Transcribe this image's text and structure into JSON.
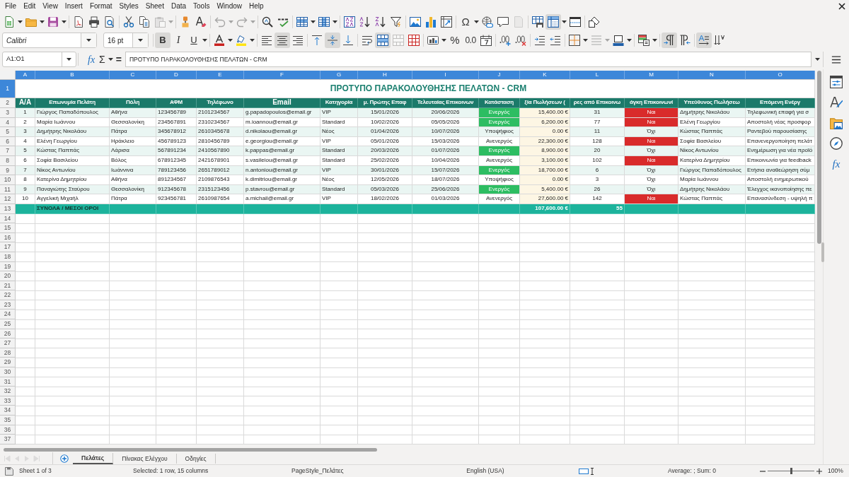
{
  "menu_bar": {
    "items": [
      "File",
      "Edit",
      "View",
      "Insert",
      "Format",
      "Styles",
      "Sheet",
      "Data",
      "Tools",
      "Window",
      "Help"
    ]
  },
  "standard_toolbar": {
    "paste": {
      "disabled": true
    },
    "undo": {
      "disabled": true
    },
    "redo": {
      "disabled": true
    },
    "special_character": {
      "label": "Ω"
    },
    "header_footer": {
      "disabled": true
    },
    "freeze": {
      "on": true
    }
  },
  "formatting_toolbar": {
    "font_name": "Calibri",
    "font_size": "16 pt",
    "bold": {
      "label": "B",
      "on": true
    },
    "italic": {
      "label": "I",
      "on": false
    },
    "underline": {
      "label": "U",
      "on": false
    },
    "align_left": {
      "on": false
    },
    "align_center": {
      "on": true
    },
    "align_right": {
      "on": false
    },
    "align_top": {
      "on": false
    },
    "center_vertically": {
      "on": true
    },
    "align_bottom": {
      "on": false
    },
    "wrap_text": {
      "on": false
    },
    "merge_and_center": {
      "on": true
    },
    "merge_cells": {
      "disabled": true
    },
    "percent": {
      "label": "%"
    },
    "number": {
      "label": "0.0"
    },
    "border_style": {
      "disabled": true
    },
    "left_to_right": {
      "on": true
    },
    "right_to_left": {
      "on": false
    },
    "text_left_to_right": {
      "on": true
    },
    "text_top_to_bottom": {
      "on": false
    }
  },
  "formula_bar": {
    "name_box": "A1:O1",
    "function_wizard": "fx",
    "sum": "Σ",
    "formula": "=",
    "content": "ΠΡΟΤΥΠΟ ΠΑΡΑΚΟΛΟΥΘΗΣΗΣ ΠΕΛΑΤΩΝ - CRM"
  },
  "sheet": {
    "column_headers": [
      {
        "label": "A",
        "selected": true
      },
      {
        "label": "B",
        "selected": true
      },
      {
        "label": "C",
        "selected": true
      },
      {
        "label": "D",
        "selected": true
      },
      {
        "label": "E",
        "selected": true
      },
      {
        "label": "F",
        "selected": true
      },
      {
        "label": "G",
        "selected": true
      },
      {
        "label": "H",
        "selected": true
      },
      {
        "label": "I",
        "selected": true
      },
      {
        "label": "J",
        "selected": true
      },
      {
        "label": "K",
        "selected": true
      },
      {
        "label": "L",
        "selected": true
      },
      {
        "label": "M",
        "selected": true
      },
      {
        "label": "N",
        "selected": true
      },
      {
        "label": "O",
        "selected": true
      }
    ],
    "row_headers": [
      {
        "label": "1",
        "selected": true
      },
      {
        "label": "2",
        "selected": false
      },
      {
        "label": "3",
        "selected": false
      },
      {
        "label": "4",
        "selected": false
      },
      {
        "label": "5",
        "selected": false
      },
      {
        "label": "6",
        "selected": false
      },
      {
        "label": "7",
        "selected": false
      },
      {
        "label": "8",
        "selected": false
      },
      {
        "label": "9",
        "selected": false
      },
      {
        "label": "10",
        "selected": false
      },
      {
        "label": "11",
        "selected": false
      },
      {
        "label": "12",
        "selected": false
      },
      {
        "label": "13",
        "selected": false
      },
      {
        "label": "14",
        "selected": false
      },
      {
        "label": "15",
        "selected": false
      },
      {
        "label": "16",
        "selected": false
      },
      {
        "label": "17",
        "selected": false
      },
      {
        "label": "18",
        "selected": false
      },
      {
        "label": "19",
        "selected": false
      },
      {
        "label": "20",
        "selected": false
      },
      {
        "label": "21",
        "selected": false
      },
      {
        "label": "22",
        "selected": false
      },
      {
        "label": "23",
        "selected": false
      },
      {
        "label": "24",
        "selected": false
      },
      {
        "label": "25",
        "selected": false
      },
      {
        "label": "26",
        "selected": false
      },
      {
        "label": "27",
        "selected": false
      },
      {
        "label": "28",
        "selected": false
      },
      {
        "label": "29",
        "selected": false
      },
      {
        "label": "30",
        "selected": false
      },
      {
        "label": "31",
        "selected": false
      },
      {
        "label": "32",
        "selected": false
      },
      {
        "label": "33",
        "selected": false
      },
      {
        "label": "34",
        "selected": false
      },
      {
        "label": "35",
        "selected": false
      },
      {
        "label": "36",
        "selected": false
      },
      {
        "label": "37",
        "selected": false
      }
    ],
    "title": "ΠΡΟΤΥΠΟ ΠΑΡΑΚΟΛΟΥΘΗΣΗΣ ΠΕΛΑΤΩΝ - CRM",
    "columns": [
      "Α/Α",
      "Επωνυμία Πελάτη",
      "Πόλη",
      "ΑΦΜ",
      "Τηλέφωνο",
      "Email",
      "Κατηγορία",
      "μ. Πρώτης Επαφ",
      "Τελευταίας Επικοινων",
      "Κατάσταση",
      "ξία Πωλήσεων (",
      "ρες από Επικοινω",
      "άγκη Επικοινωνί",
      "Υπεύθυνος Πωλήσεω",
      "Επόμενη Ενέργ"
    ],
    "rows": [
      {
        "cells": [
          "1",
          "Γιώργος Παπαδόπουλος",
          "Αθήνα",
          "123456789",
          "2101234567",
          "g.papadopoulos@email.gr",
          "VIP",
          "15/01/2026",
          "20/06/2026",
          "Ενεργός",
          "15,400.00 €",
          "31",
          "Ναι",
          "Δημήτρης Νικολάου",
          "Τηλεφωνική επαφή για σ"
        ],
        "status_highlighted": true,
        "contact_highlighted": true
      },
      {
        "cells": [
          "2",
          "Μαρία Ιωάννου",
          "Θεσσαλονίκη",
          "234567891",
          "2310234567",
          "m.ioannou@email.gr",
          "Standard",
          "10/02/2026",
          "05/05/2026",
          "Ενεργός",
          "6,200.00 €",
          "77",
          "Ναι",
          "Ελένη Γεωργίου",
          "Αποστολή νέας προσφορ"
        ],
        "status_highlighted": true,
        "contact_highlighted": true
      },
      {
        "cells": [
          "3",
          "Δημήτρης Νικολάου",
          "Πάτρα",
          "345678912",
          "2610345678",
          "d.nikolaou@email.gr",
          "Νέος",
          "01/04/2026",
          "10/07/2026",
          "Υποψήφιος",
          "0.00 €",
          "11",
          "Όχι",
          "Κώστας Παππάς",
          "Ραντεβού παρουσίασης"
        ],
        "status_highlighted": false,
        "contact_highlighted": false
      },
      {
        "cells": [
          "4",
          "Ελένη Γεωργίου",
          "Ηράκλειο",
          "456789123",
          "2810456789",
          "e.georgiou@email.gr",
          "VIP",
          "05/01/2026",
          "15/03/2026",
          "Ανενεργός",
          "22,300.00 €",
          "128",
          "Ναι",
          "Σοφία Βασιλείου",
          "Επανενεργοποίηση πελάτ"
        ],
        "status_highlighted": false,
        "contact_highlighted": true
      },
      {
        "cells": [
          "5",
          "Κώστας Παππάς",
          "Λάρισα",
          "567891234",
          "2410567890",
          "k.pappas@email.gr",
          "Standard",
          "20/03/2026",
          "01/07/2026",
          "Ενεργός",
          "8,900.00 €",
          "20",
          "Όχι",
          "Νίκος Αντωνίου",
          "Ενημέρωση για νέα προϊό"
        ],
        "status_highlighted": true,
        "contact_highlighted": false
      },
      {
        "cells": [
          "6",
          "Σοφία Βασιλείου",
          "Βόλος",
          "678912345",
          "2421678901",
          "s.vasileiou@email.gr",
          "Standard",
          "25/02/2026",
          "10/04/2026",
          "Ανενεργός",
          "3,100.00 €",
          "102",
          "Ναι",
          "Κατερίνα Δημητρίου",
          "Επικοινωνία για feedback"
        ],
        "status_highlighted": false,
        "contact_highlighted": true
      },
      {
        "cells": [
          "7",
          "Νίκος Αντωνίου",
          "Ιωάννινα",
          "789123456",
          "2651789012",
          "n.antoniou@email.gr",
          "VIP",
          "30/01/2026",
          "15/07/2026",
          "Ενεργός",
          "18,700.00 €",
          "6",
          "Όχι",
          "Γιώργος Παπαδόπουλος",
          "Ετήσια αναθεώρηση σύμ"
        ],
        "status_highlighted": true,
        "contact_highlighted": false
      },
      {
        "cells": [
          "8",
          "Κατερίνα Δημητρίου",
          "Αθήνα",
          "891234567",
          "2109876543",
          "k.dimitriou@email.gr",
          "Νέος",
          "12/05/2026",
          "18/07/2026",
          "Υποψήφιος",
          "0.00 €",
          "3",
          "Όχι",
          "Μαρία Ιωάννου",
          "Αποστολή ενημερωτικού"
        ],
        "status_highlighted": false,
        "contact_highlighted": false
      },
      {
        "cells": [
          "9",
          "Παναγιώτης Σταύρου",
          "Θεσσαλονίκη",
          "912345678",
          "2315123456",
          "p.stavrou@email.gr",
          "Standard",
          "05/03/2026",
          "25/06/2026",
          "Ενεργός",
          "5,400.00 €",
          "26",
          "Όχι",
          "Δημήτρης Νικολάου",
          "Έλεγχος ικανοποίησης πε"
        ],
        "status_highlighted": true,
        "contact_highlighted": false
      },
      {
        "cells": [
          "10",
          "Αγγελική Μιχαήλ",
          "Πάτρα",
          "923456781",
          "2610987654",
          "a.michail@email.gr",
          "VIP",
          "18/02/2026",
          "01/03/2026",
          "Ανενεργός",
          "27,600.00 €",
          "142",
          "Ναι",
          "Κώστας Παππάς",
          "Επανασύνδεση - υψηλή π"
        ],
        "status_highlighted": false,
        "contact_highlighted": true
      }
    ],
    "totals": {
      "label": "ΣΥΝΟΛΑ / ΜΕΣΟΙ ΟΡΟΙ",
      "sales": "107,600.00 €",
      "days": "55"
    }
  },
  "sheet_tabs": [
    {
      "label": "Πελάτες",
      "selected": true
    },
    {
      "label": "Πίνακας Ελέγχου",
      "selected": false
    },
    {
      "label": "Οδηγίες",
      "selected": false
    }
  ],
  "sidebar": {
    "functions": "fx"
  },
  "status_bar": {
    "sheet": "Sheet 1 of 3",
    "selection": "Selected: 1 row, 15 columns",
    "page_style": "PageStyle_Πελάτες",
    "language": "English (USA)",
    "summary": "Average: ; Sum: 0",
    "zoom_slider": {
      "level": 0.5
    },
    "zoom": "100%"
  }
}
